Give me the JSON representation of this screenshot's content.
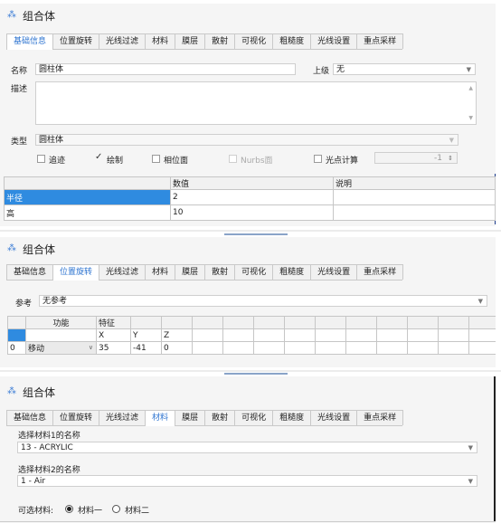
{
  "panel1": {
    "title": "组合体",
    "tabs": [
      "基础信息",
      "位置旋转",
      "光线过滤",
      "材料",
      "膜层",
      "散射",
      "可视化",
      "粗糙度",
      "光线设置",
      "重点采样"
    ],
    "active_tab": "基础信息",
    "name_label": "名称",
    "name_value": "圆柱体",
    "parent_label": "上级",
    "parent_value": "无",
    "desc_label": "描述",
    "desc_value": "",
    "type_label": "类型",
    "type_value": "圆柱体",
    "checks": {
      "trace": {
        "label": "追迹",
        "checked": false
      },
      "draw": {
        "label": "绘制",
        "checked": true
      },
      "phase": {
        "label": "相位面",
        "checked": false
      },
      "nurbs": {
        "label": "Nurbs面",
        "checked": false
      },
      "spot": {
        "label": "光点计算",
        "checked": false
      }
    },
    "spot_value": "-1",
    "table": {
      "headers": [
        "",
        "数值",
        "说明"
      ],
      "rows": [
        {
          "name": "半径",
          "value": "2",
          "desc": ""
        },
        {
          "name": "高",
          "value": "10",
          "desc": ""
        }
      ]
    }
  },
  "panel2": {
    "title": "组合体",
    "tabs": [
      "基础信息",
      "位置旋转",
      "光线过滤",
      "材料",
      "膜层",
      "散射",
      "可视化",
      "粗糙度",
      "光线设置",
      "重点采样"
    ],
    "active_tab": "位置旋转",
    "ref_label": "参考",
    "ref_value": "无参考",
    "table": {
      "h_func": "功能",
      "h_feature": "特征",
      "h_x": "X",
      "h_y": "Y",
      "h_z": "Z",
      "row": {
        "index": "0",
        "func": "移动",
        "x": "35",
        "y": "-41",
        "z": "0"
      }
    }
  },
  "panel3": {
    "title": "组合体",
    "tabs": [
      "基础信息",
      "位置旋转",
      "光线过滤",
      "材料",
      "膜层",
      "散射",
      "可视化",
      "粗糙度",
      "光线设置",
      "重点采样"
    ],
    "active_tab": "材料",
    "mat1_label": "选择材料1的名称",
    "mat1_value": "13 - ACRYLIC",
    "mat2_label": "选择材料2的名称",
    "mat2_value": "1 - Air",
    "optional_label": "可选材料:",
    "opt1": "材料一",
    "opt2": "材料二",
    "selected_opt": "材料一"
  },
  "colors": {
    "accent": "#2e74d0",
    "selection": "#2f8be0",
    "panel_bg": "#f5f5f5"
  },
  "icons": {
    "title": "component-icon",
    "dropdown": "chevron-down-icon",
    "scroll_up": "scroll-up-icon",
    "scroll_down": "scroll-down-icon",
    "spinner": "spinner-icon"
  }
}
